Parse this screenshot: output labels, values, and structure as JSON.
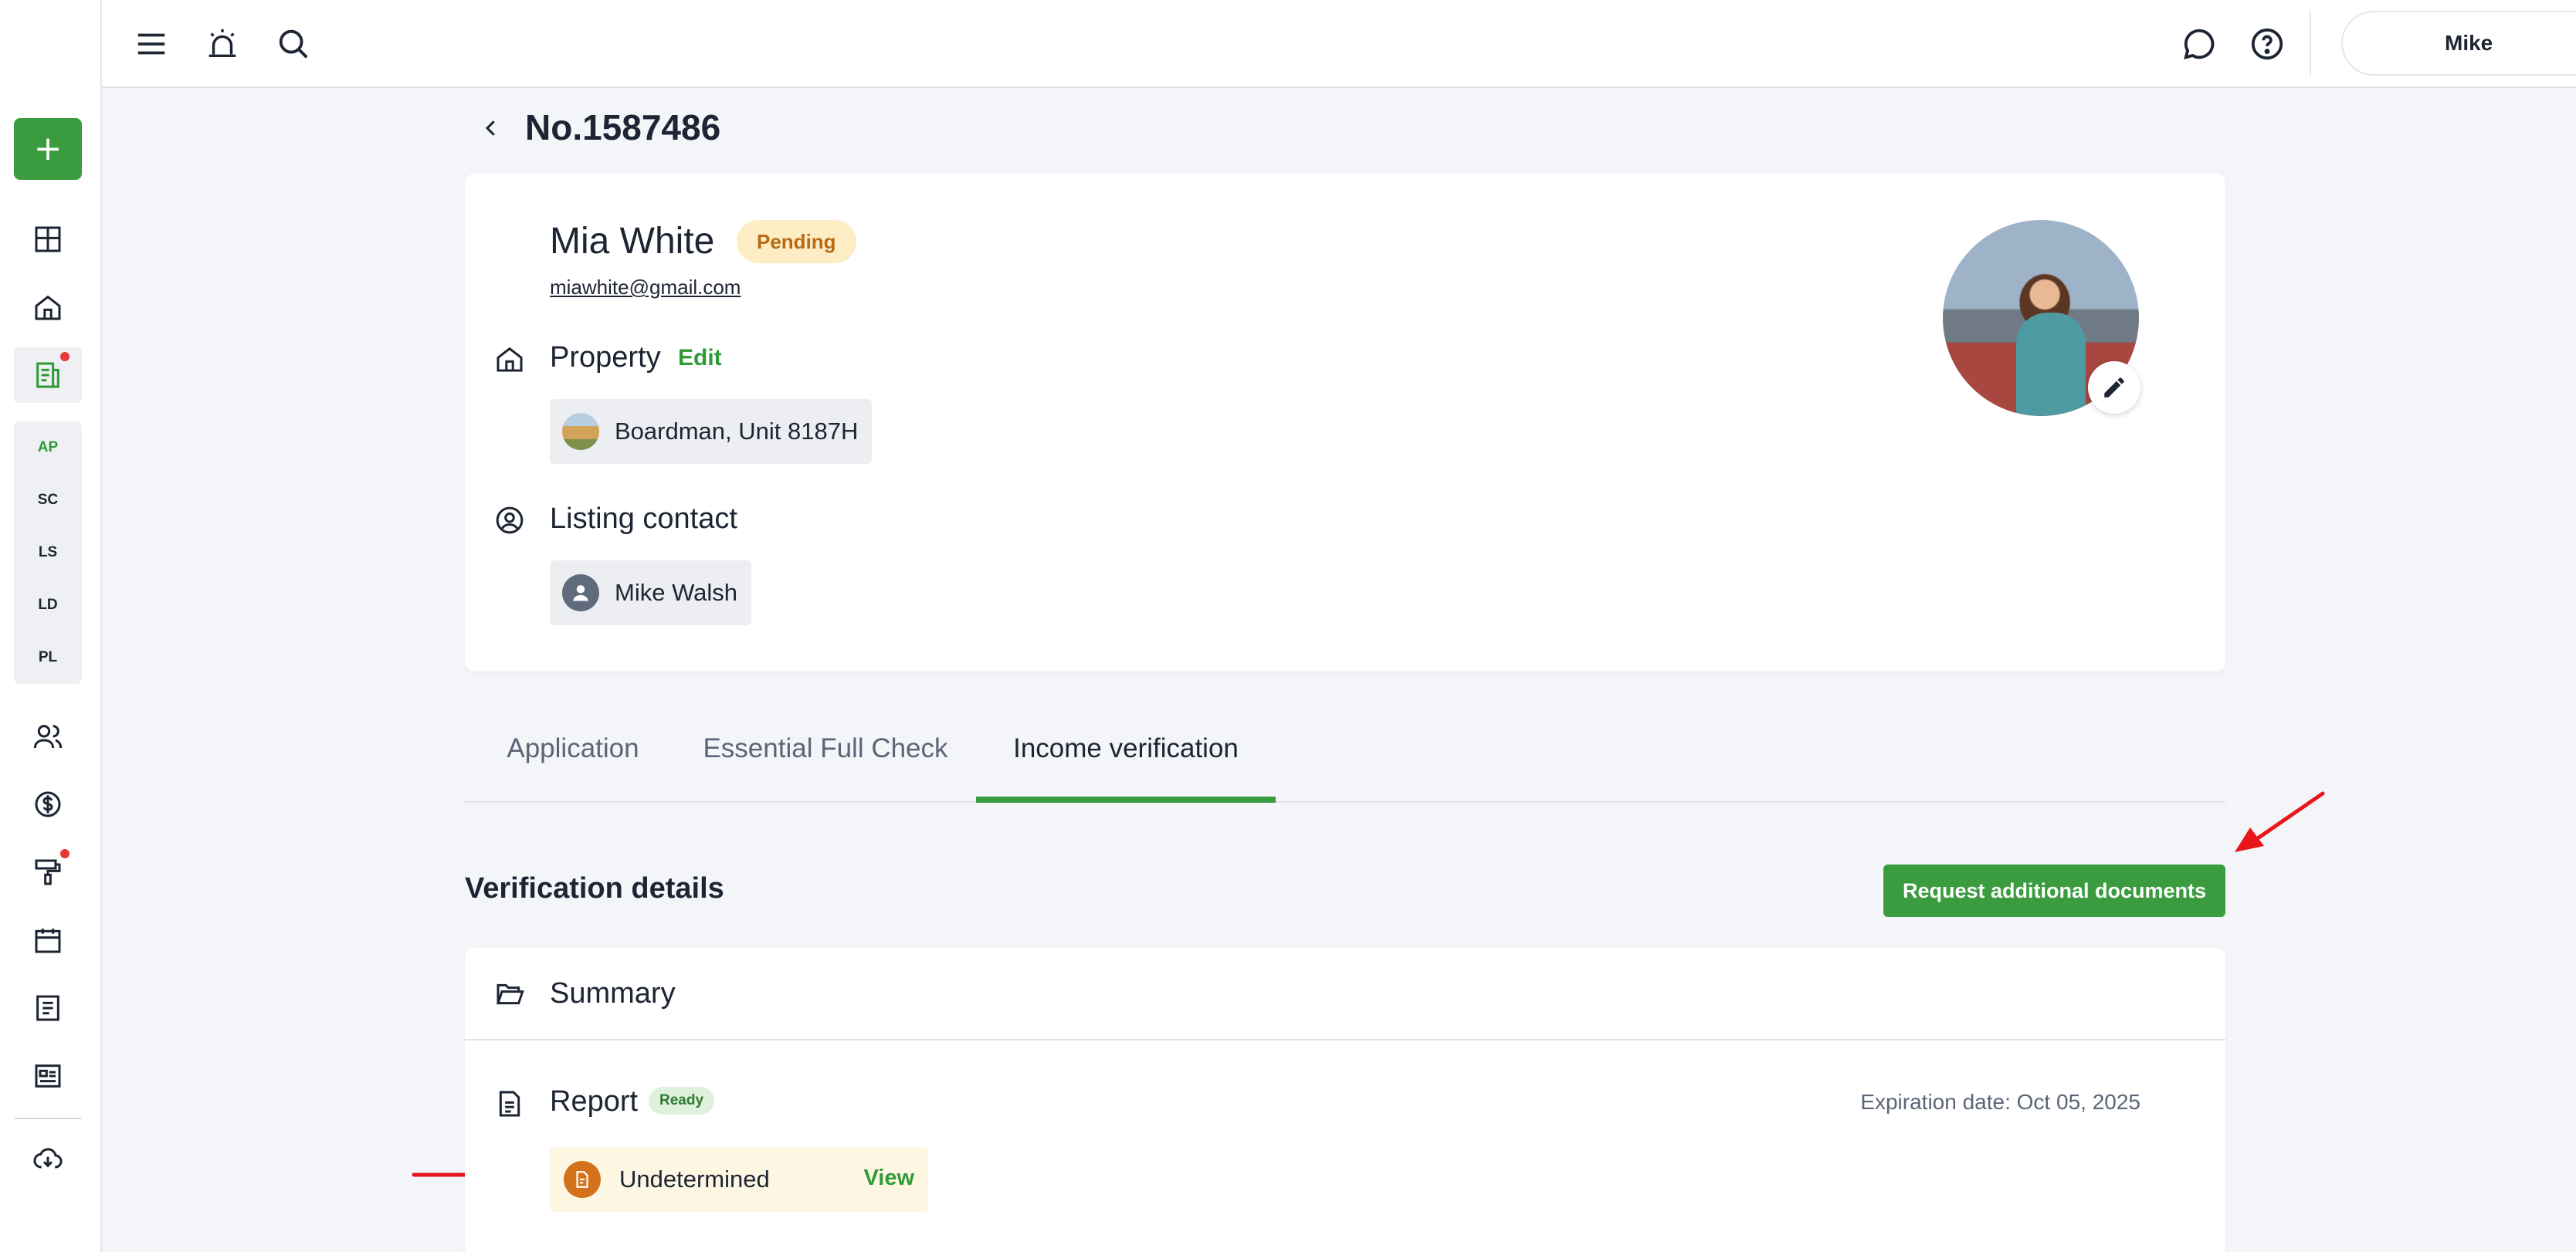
{
  "topbar": {
    "user_name": "Mike"
  },
  "sidebar": {
    "add_label": "+",
    "codes": [
      "AP",
      "SC",
      "LS",
      "LD",
      "PL"
    ]
  },
  "page": {
    "title": "No.1587486"
  },
  "applicant": {
    "name": "Mia White",
    "status": "Pending",
    "email": "miawhite@gmail.com"
  },
  "property": {
    "heading": "Property",
    "edit_label": "Edit",
    "value": "Boardman, Unit 8187H"
  },
  "listing_contact": {
    "heading": "Listing contact",
    "value": "Mike Walsh"
  },
  "tabs": [
    {
      "label": "Application"
    },
    {
      "label": "Essential Full Check"
    },
    {
      "label": "Income verification"
    }
  ],
  "verification": {
    "title": "Verification details",
    "request_button": "Request additional documents",
    "summary_title": "Summary",
    "report_title": "Report",
    "report_status": "Ready",
    "expiration": "Expiration date: Oct 05, 2025",
    "result_label": "Undetermined",
    "view_label": "View"
  },
  "colors": {
    "accent": "#3a9c3f",
    "pending_bg": "#fdedc4",
    "pending_text": "#b86a12",
    "annotation_arrow": "#e8161b"
  }
}
